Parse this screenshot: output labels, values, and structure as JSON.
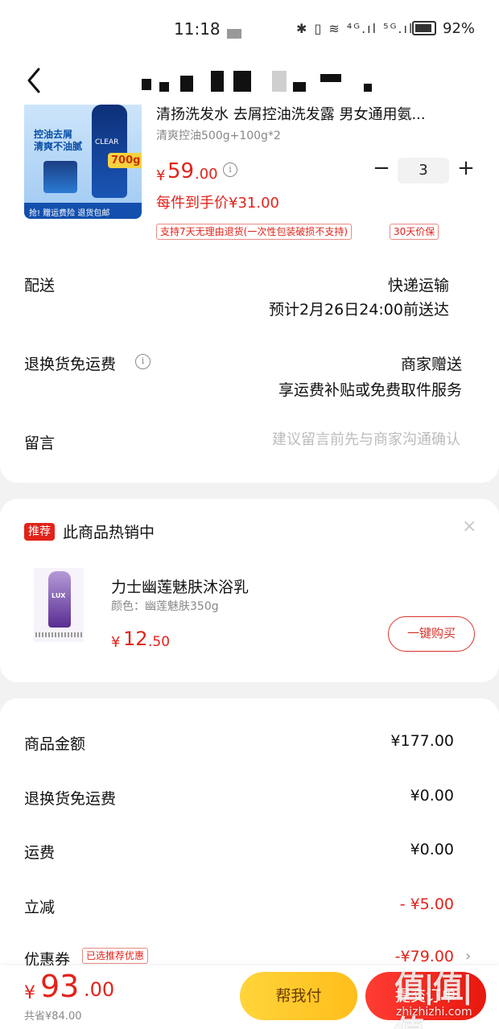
{
  "status_bar": {
    "time": "11:18",
    "icons": "✱ ▯ ≋ ⁴ᴳ.ıl ⁵ᴳ.ıl",
    "battery_pct": "92%"
  },
  "product": {
    "title": "清扬洗发水 去屑控油洗发露 男女通用氨...",
    "spec": "清爽控油500g+100g*2",
    "price_yen": "¥",
    "price_int": "59",
    "price_dec": ".00",
    "info_icon": "i",
    "quantity": "3",
    "minus": "−",
    "plus": "+",
    "unit_price": "每件到手价¥31.00",
    "policy_return": "支持7天无理由退货(一次性包装破损不支持)",
    "policy_guard": "30天价保",
    "image_text_1": "控油去屑",
    "image_text_2": "清爽不油腻",
    "image_brand": "CLEAR",
    "image_badge": "700g",
    "image_strip": "抢! 赠运费险 退货包邮"
  },
  "delivery": {
    "label": "配送",
    "method": "快递运输",
    "eta": "预计2月26日24:00前送达"
  },
  "return_shipping": {
    "label": "退换货免运费",
    "info_icon": "i",
    "value": "商家赠送",
    "desc": "享运费补贴或免费取件服务"
  },
  "note": {
    "label": "留言",
    "placeholder": "建议留言前先与商家沟通确认"
  },
  "recommend": {
    "badge": "推荐",
    "title": "此商品热销中",
    "close": "×",
    "name": "力士幽莲魅肤沐浴乳",
    "spec": "颜色：幽莲魅肤350g",
    "price_yen": "¥",
    "price_int": "12",
    "price_dec": ".50",
    "buy_label": "一键购买",
    "image_brand": "LUX"
  },
  "summary": {
    "goods_label": "商品金额",
    "goods_value": "¥177.00",
    "return_label": "退换货免运费",
    "return_value": "¥0.00",
    "shipping_label": "运费",
    "shipping_value": "¥0.00",
    "discount_label": "立减",
    "discount_value": "- ¥5.00",
    "coupon_label": "优惠券",
    "coupon_tag": "已选推荐优惠",
    "coupon_value": "-¥79.00",
    "coupon_chevron": "›"
  },
  "bottom": {
    "total_yen": "¥",
    "total_int": "93",
    "total_dec": ".00",
    "saved": "共省¥84.00",
    "help_pay_label": "帮我付",
    "submit_label": "提交订单"
  },
  "watermark": {
    "main": "值|值|值",
    "sub": "zhizhizhi.com"
  },
  "colors": {
    "accent_red": "#e2231a",
    "help_pay_yellow": "#ffc928",
    "background": "#f2f2f2"
  }
}
